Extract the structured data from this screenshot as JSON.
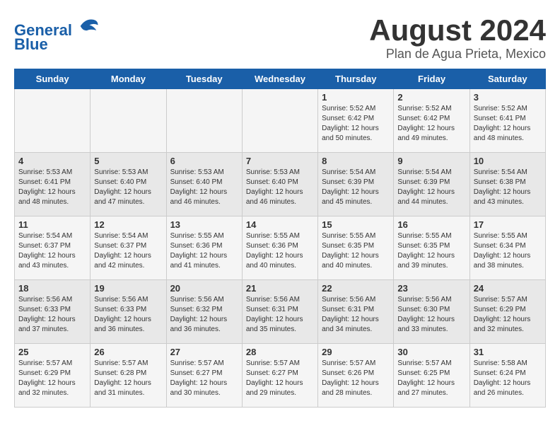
{
  "header": {
    "logo_line1": "General",
    "logo_line2": "Blue",
    "title": "August 2024",
    "subtitle": "Plan de Agua Prieta, Mexico"
  },
  "weekdays": [
    "Sunday",
    "Monday",
    "Tuesday",
    "Wednesday",
    "Thursday",
    "Friday",
    "Saturday"
  ],
  "weeks": [
    [
      {
        "day": "",
        "info": ""
      },
      {
        "day": "",
        "info": ""
      },
      {
        "day": "",
        "info": ""
      },
      {
        "day": "",
        "info": ""
      },
      {
        "day": "1",
        "info": "Sunrise: 5:52 AM\nSunset: 6:42 PM\nDaylight: 12 hours\nand 50 minutes."
      },
      {
        "day": "2",
        "info": "Sunrise: 5:52 AM\nSunset: 6:42 PM\nDaylight: 12 hours\nand 49 minutes."
      },
      {
        "day": "3",
        "info": "Sunrise: 5:52 AM\nSunset: 6:41 PM\nDaylight: 12 hours\nand 48 minutes."
      }
    ],
    [
      {
        "day": "4",
        "info": "Sunrise: 5:53 AM\nSunset: 6:41 PM\nDaylight: 12 hours\nand 48 minutes."
      },
      {
        "day": "5",
        "info": "Sunrise: 5:53 AM\nSunset: 6:40 PM\nDaylight: 12 hours\nand 47 minutes."
      },
      {
        "day": "6",
        "info": "Sunrise: 5:53 AM\nSunset: 6:40 PM\nDaylight: 12 hours\nand 46 minutes."
      },
      {
        "day": "7",
        "info": "Sunrise: 5:53 AM\nSunset: 6:40 PM\nDaylight: 12 hours\nand 46 minutes."
      },
      {
        "day": "8",
        "info": "Sunrise: 5:54 AM\nSunset: 6:39 PM\nDaylight: 12 hours\nand 45 minutes."
      },
      {
        "day": "9",
        "info": "Sunrise: 5:54 AM\nSunset: 6:39 PM\nDaylight: 12 hours\nand 44 minutes."
      },
      {
        "day": "10",
        "info": "Sunrise: 5:54 AM\nSunset: 6:38 PM\nDaylight: 12 hours\nand 43 minutes."
      }
    ],
    [
      {
        "day": "11",
        "info": "Sunrise: 5:54 AM\nSunset: 6:37 PM\nDaylight: 12 hours\nand 43 minutes."
      },
      {
        "day": "12",
        "info": "Sunrise: 5:54 AM\nSunset: 6:37 PM\nDaylight: 12 hours\nand 42 minutes."
      },
      {
        "day": "13",
        "info": "Sunrise: 5:55 AM\nSunset: 6:36 PM\nDaylight: 12 hours\nand 41 minutes."
      },
      {
        "day": "14",
        "info": "Sunrise: 5:55 AM\nSunset: 6:36 PM\nDaylight: 12 hours\nand 40 minutes."
      },
      {
        "day": "15",
        "info": "Sunrise: 5:55 AM\nSunset: 6:35 PM\nDaylight: 12 hours\nand 40 minutes."
      },
      {
        "day": "16",
        "info": "Sunrise: 5:55 AM\nSunset: 6:35 PM\nDaylight: 12 hours\nand 39 minutes."
      },
      {
        "day": "17",
        "info": "Sunrise: 5:55 AM\nSunset: 6:34 PM\nDaylight: 12 hours\nand 38 minutes."
      }
    ],
    [
      {
        "day": "18",
        "info": "Sunrise: 5:56 AM\nSunset: 6:33 PM\nDaylight: 12 hours\nand 37 minutes."
      },
      {
        "day": "19",
        "info": "Sunrise: 5:56 AM\nSunset: 6:33 PM\nDaylight: 12 hours\nand 36 minutes."
      },
      {
        "day": "20",
        "info": "Sunrise: 5:56 AM\nSunset: 6:32 PM\nDaylight: 12 hours\nand 36 minutes."
      },
      {
        "day": "21",
        "info": "Sunrise: 5:56 AM\nSunset: 6:31 PM\nDaylight: 12 hours\nand 35 minutes."
      },
      {
        "day": "22",
        "info": "Sunrise: 5:56 AM\nSunset: 6:31 PM\nDaylight: 12 hours\nand 34 minutes."
      },
      {
        "day": "23",
        "info": "Sunrise: 5:56 AM\nSunset: 6:30 PM\nDaylight: 12 hours\nand 33 minutes."
      },
      {
        "day": "24",
        "info": "Sunrise: 5:57 AM\nSunset: 6:29 PM\nDaylight: 12 hours\nand 32 minutes."
      }
    ],
    [
      {
        "day": "25",
        "info": "Sunrise: 5:57 AM\nSunset: 6:29 PM\nDaylight: 12 hours\nand 32 minutes."
      },
      {
        "day": "26",
        "info": "Sunrise: 5:57 AM\nSunset: 6:28 PM\nDaylight: 12 hours\nand 31 minutes."
      },
      {
        "day": "27",
        "info": "Sunrise: 5:57 AM\nSunset: 6:27 PM\nDaylight: 12 hours\nand 30 minutes."
      },
      {
        "day": "28",
        "info": "Sunrise: 5:57 AM\nSunset: 6:27 PM\nDaylight: 12 hours\nand 29 minutes."
      },
      {
        "day": "29",
        "info": "Sunrise: 5:57 AM\nSunset: 6:26 PM\nDaylight: 12 hours\nand 28 minutes."
      },
      {
        "day": "30",
        "info": "Sunrise: 5:57 AM\nSunset: 6:25 PM\nDaylight: 12 hours\nand 27 minutes."
      },
      {
        "day": "31",
        "info": "Sunrise: 5:58 AM\nSunset: 6:24 PM\nDaylight: 12 hours\nand 26 minutes."
      }
    ]
  ]
}
